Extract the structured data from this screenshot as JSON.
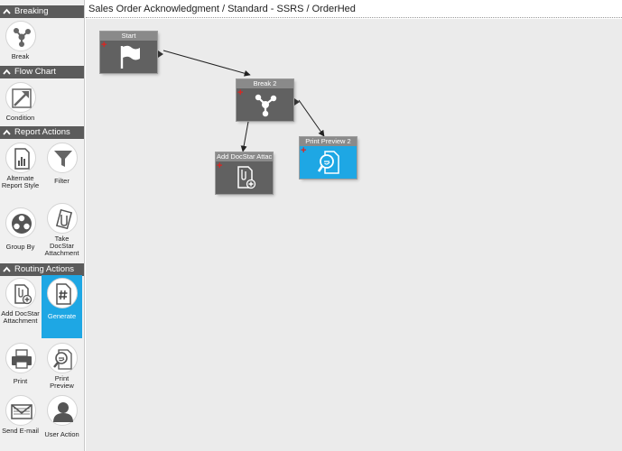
{
  "breadcrumb": "Sales Order Acknowledgment / Standard - SSRS / OrderHed",
  "sidebar": {
    "sections": [
      {
        "title": "Breaking",
        "tools": [
          {
            "label": "Break",
            "icon": "break-icon"
          }
        ]
      },
      {
        "title": "Flow Chart",
        "tools": [
          {
            "label": "Condition",
            "icon": "condition-icon"
          }
        ]
      },
      {
        "title": "Report Actions",
        "tools": [
          {
            "label": "Alternate Report Style",
            "icon": "report-style-icon"
          },
          {
            "label": "Filter",
            "icon": "filter-icon"
          },
          {
            "label": "Group By",
            "icon": "group-by-icon"
          },
          {
            "label": "Take DocStar Attachment",
            "icon": "take-attachment-icon"
          }
        ]
      },
      {
        "title": "Routing Actions",
        "tools": [
          {
            "label": "Add DocStar Attachment",
            "icon": "add-attachment-icon"
          },
          {
            "label": "Generate",
            "icon": "generate-icon",
            "active": true
          },
          {
            "label": "Print",
            "icon": "printer-icon"
          },
          {
            "label": "Print Preview",
            "icon": "print-preview-icon"
          },
          {
            "label": "Send E-mail",
            "icon": "email-icon"
          },
          {
            "label": "User Action",
            "icon": "user-icon"
          }
        ]
      }
    ]
  },
  "canvas": {
    "nodes": [
      {
        "title": "Start",
        "icon": "flag-icon"
      },
      {
        "title": "Break 2",
        "icon": "break-icon"
      },
      {
        "title": "Add DocStar Attac",
        "icon": "add-attachment-icon"
      },
      {
        "title": "Print Preview 2",
        "icon": "print-preview-icon",
        "active": true
      }
    ]
  },
  "colors": {
    "header": "#5b5b5b",
    "accent": "#1ea7e4",
    "node_body": "#616161",
    "node_head": "#8a8a8a",
    "plus": "#e0231f",
    "canvas": "#ebebeb"
  }
}
